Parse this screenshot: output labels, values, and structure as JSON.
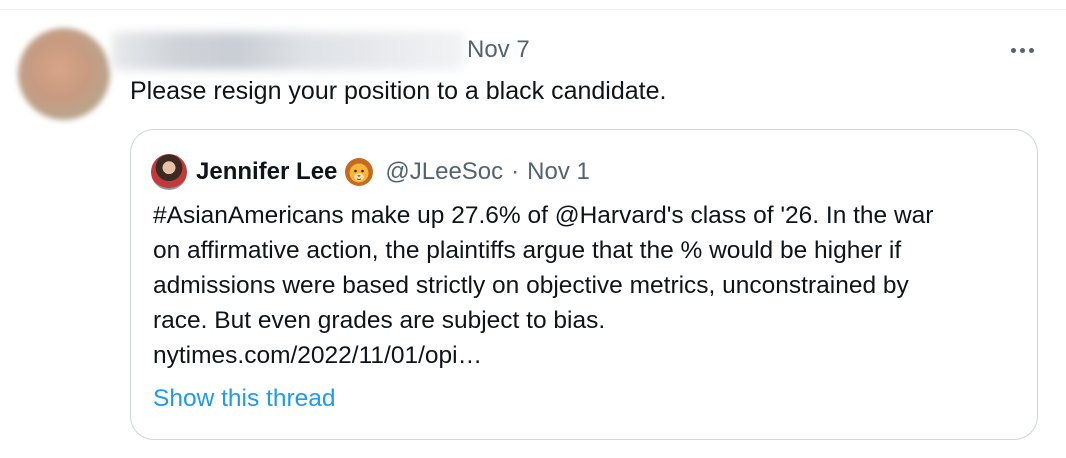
{
  "tweet": {
    "timestamp": "Nov 7",
    "text": "Please resign your position to a black candidate.",
    "more_icon": "more-horizontal-icon"
  },
  "quote": {
    "author_name": "Jennifer Lee",
    "author_emoji": "🦁",
    "handle": "@JLeeSoc",
    "separator": "·",
    "date": "Nov 1",
    "body_lines": [
      "#AsianAmericans make up 27.6% of @Harvard's class of '26. In the war",
      "on affirmative action, the plaintiffs argue that the % would be higher if",
      "admissions were based strictly on objective metrics, unconstrained by",
      "race. But even grades are subject to bias.",
      "nytimes.com/2022/11/01/opi…"
    ],
    "show_thread": "Show this thread"
  },
  "colors": {
    "text_primary": "#0f1419",
    "text_secondary": "#536471",
    "link": "#1d9bf0",
    "border": "#cfd9de"
  }
}
